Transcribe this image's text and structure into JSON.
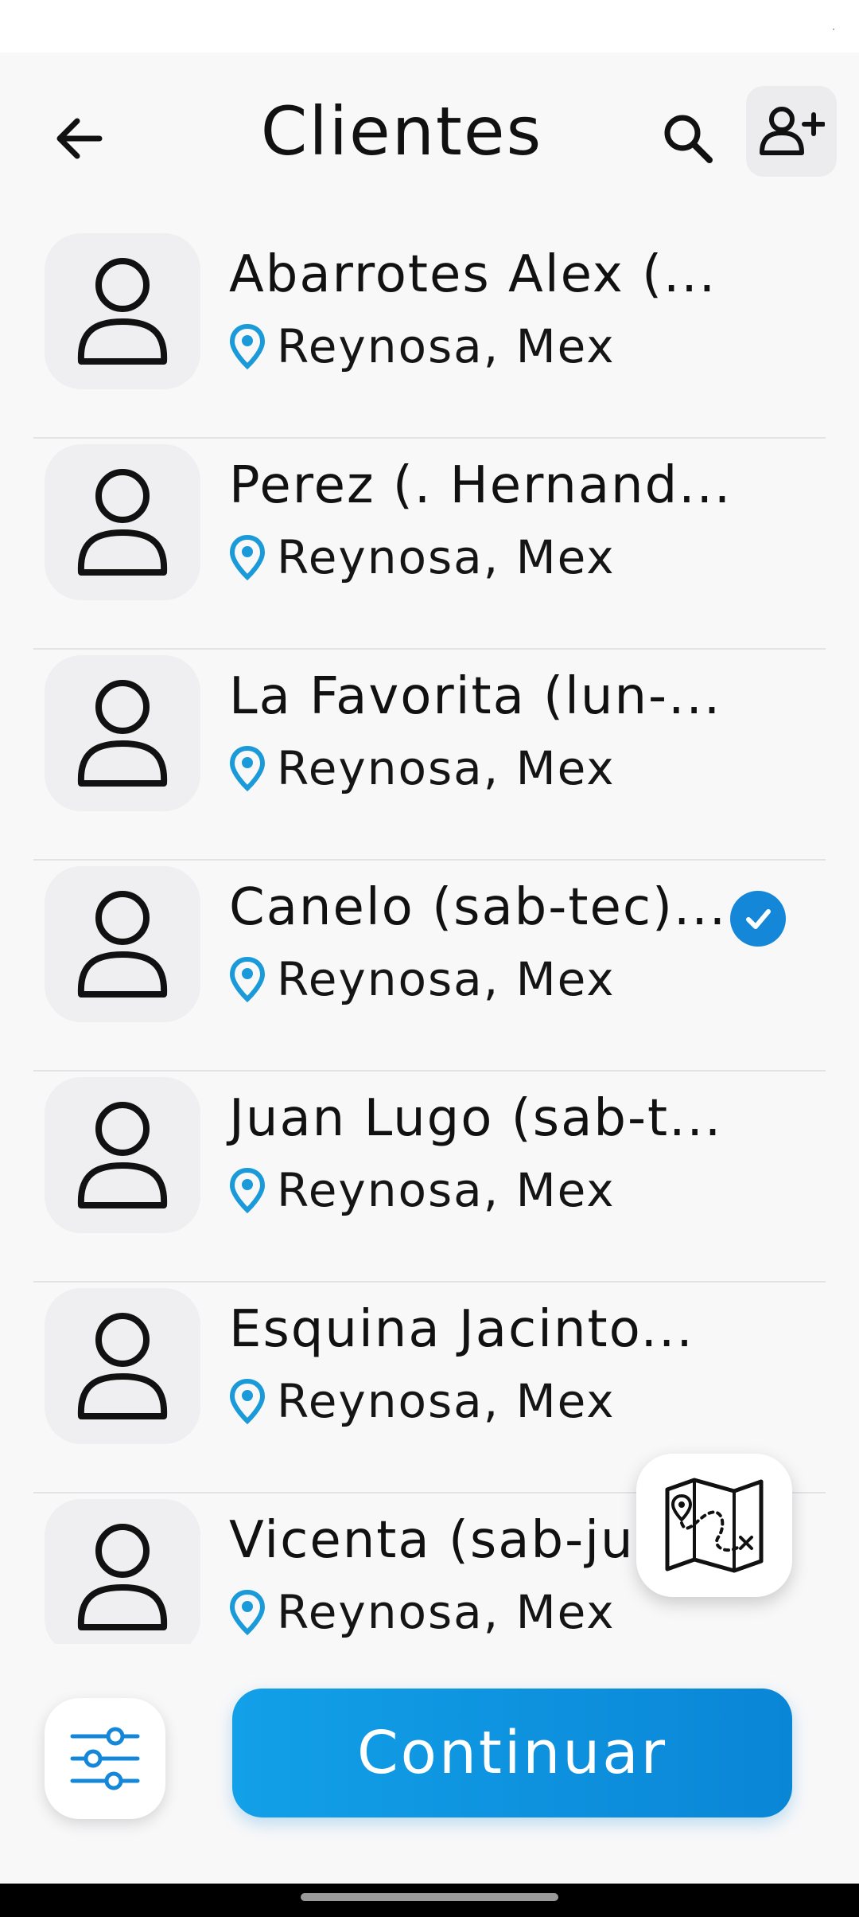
{
  "app": {
    "title": "Clientes"
  },
  "status_bar": {
    "mark": "·"
  },
  "header": {
    "back_icon": "arrow-left-icon",
    "search_icon": "search-icon",
    "add_user_icon": "user-plus-icon"
  },
  "clients": [
    {
      "name": "Abarrotes Alex (...",
      "location": "Reynosa, Mex",
      "selected": false
    },
    {
      "name": "Perez (. Hernand...",
      "location": "Reynosa, Mex",
      "selected": false
    },
    {
      "name": "La Favorita (lun-...",
      "location": "Reynosa, Mex",
      "selected": false
    },
    {
      "name": "Canelo (sab-tec)...",
      "location": "Reynosa, Mex",
      "selected": true
    },
    {
      "name": "Juan Lugo (sab-t...",
      "location": "Reynosa, Mex",
      "selected": false
    },
    {
      "name": "Esquina Jacinto...",
      "location": "Reynosa, Mex",
      "selected": false
    },
    {
      "name": "Vicenta (sab-ju",
      "location": "Reynosa, Mex",
      "selected": false
    }
  ],
  "map_button": {
    "icon": "map-icon"
  },
  "bottom": {
    "filter_icon": "sliders-icon",
    "continue_label": "Continuar"
  },
  "colors": {
    "accent": "#1487d8",
    "button_gradient_start": "#12a0e8",
    "button_gradient_end": "#0a86d6",
    "pin": "#1a9ad9"
  }
}
